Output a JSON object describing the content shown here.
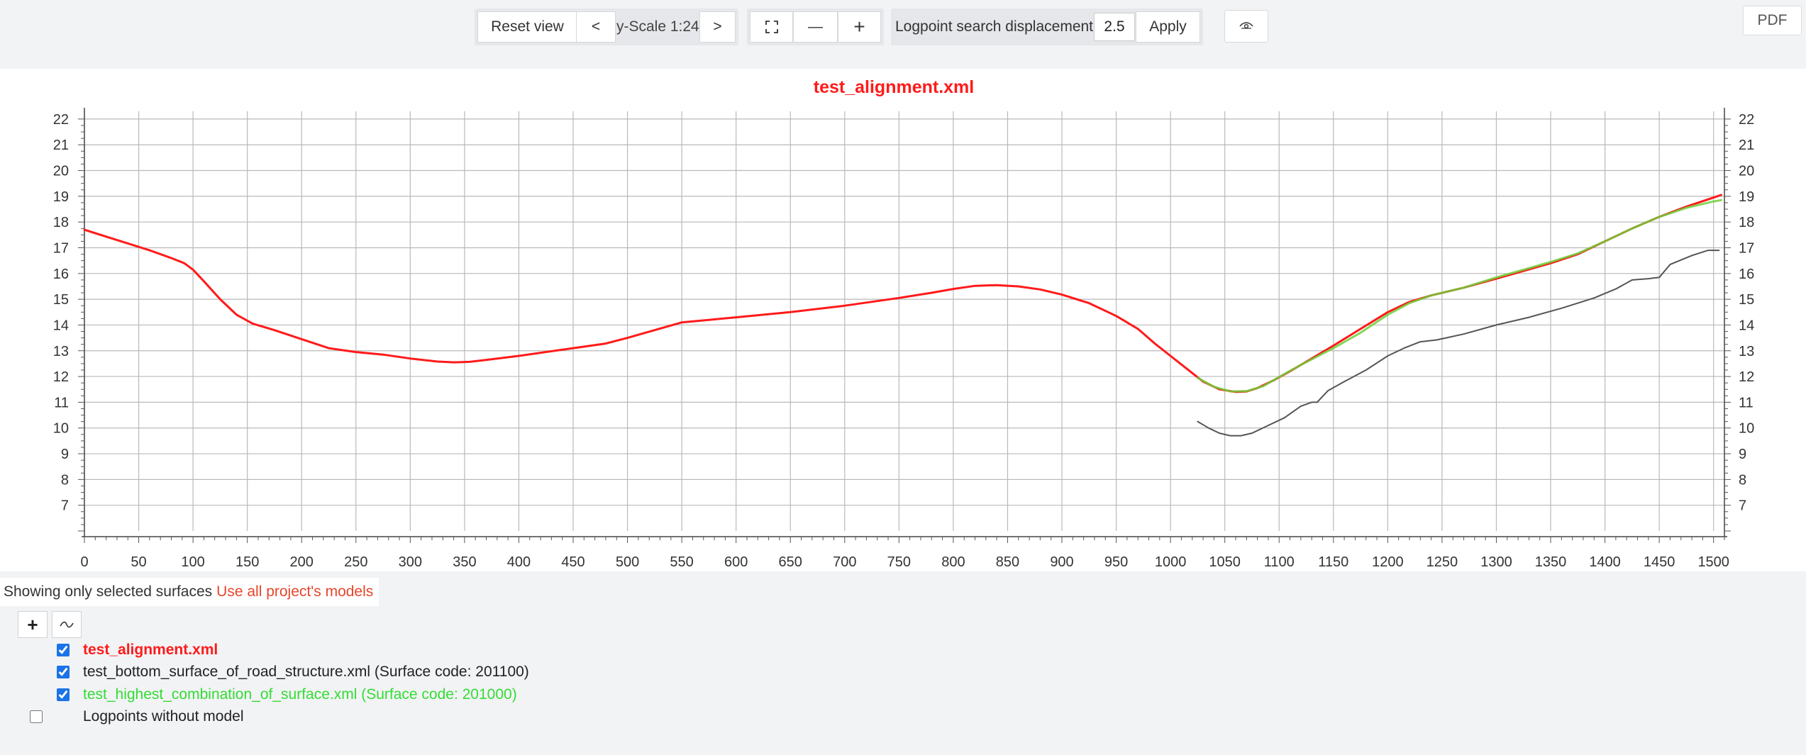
{
  "toolbar": {
    "reset_label": "Reset view",
    "prev_label": "<",
    "scale_text": "y-Scale 1:24",
    "next_label": ">",
    "fullscreen_icon": "fullscreen-icon",
    "zoom_out_label": "—",
    "zoom_in_label": "+",
    "search_label": "Logpoint search displacement",
    "search_value": "2.5",
    "apply_label": "Apply",
    "profile_icon": "eye-toggle-icon",
    "pdf_label": "PDF"
  },
  "legend": {
    "filter_text": "Showing only selected surfaces",
    "filter_link": "Use all project's models",
    "add_label": "+",
    "line_icon": "tilde-line-icon",
    "items": [
      {
        "label": "test_alignment.xml",
        "checked": true,
        "color": "#ff1a1a",
        "bold": true
      },
      {
        "label": "test_bottom_surface_of_road_structure.xml (Surface code: 201100)",
        "checked": true,
        "color": "#222222",
        "bold": false
      },
      {
        "label": "test_highest_combination_of_surface.xml (Surface code: 201000)",
        "checked": true,
        "color": "#33dd33",
        "bold": false
      },
      {
        "label": "Logpoints without model",
        "checked": false,
        "color": "#222222",
        "bold": false
      }
    ]
  },
  "chart_data": {
    "type": "line",
    "title": "test_alignment.xml",
    "xlabel": "",
    "ylabel": "",
    "xlim": [
      0,
      1510
    ],
    "ylim": [
      6,
      22.3
    ],
    "x_ticks": [
      0,
      50,
      100,
      150,
      200,
      250,
      300,
      350,
      400,
      450,
      500,
      550,
      600,
      650,
      700,
      750,
      800,
      850,
      900,
      950,
      1000,
      1050,
      1100,
      1150,
      1200,
      1250,
      1300,
      1350,
      1400,
      1450,
      1500
    ],
    "y_ticks": [
      7,
      8,
      9,
      10,
      11,
      12,
      13,
      14,
      15,
      16,
      17,
      18,
      19,
      20,
      21,
      22
    ],
    "grid": true,
    "series": [
      {
        "name": "test_alignment.xml",
        "color": "#ff1a1a",
        "points": [
          [
            0,
            17.7
          ],
          [
            30,
            17.3
          ],
          [
            60,
            16.9
          ],
          [
            80,
            16.6
          ],
          [
            92,
            16.4
          ],
          [
            100,
            16.15
          ],
          [
            110,
            15.7
          ],
          [
            125,
            15.0
          ],
          [
            140,
            14.4
          ],
          [
            155,
            14.05
          ],
          [
            175,
            13.8
          ],
          [
            200,
            13.45
          ],
          [
            225,
            13.1
          ],
          [
            250,
            12.95
          ],
          [
            275,
            12.85
          ],
          [
            300,
            12.7
          ],
          [
            325,
            12.58
          ],
          [
            340,
            12.55
          ],
          [
            355,
            12.57
          ],
          [
            375,
            12.67
          ],
          [
            400,
            12.8
          ],
          [
            450,
            13.1
          ],
          [
            480,
            13.28
          ],
          [
            500,
            13.5
          ],
          [
            525,
            13.8
          ],
          [
            550,
            14.1
          ],
          [
            575,
            14.2
          ],
          [
            600,
            14.3
          ],
          [
            650,
            14.5
          ],
          [
            700,
            14.75
          ],
          [
            750,
            15.05
          ],
          [
            780,
            15.25
          ],
          [
            800,
            15.4
          ],
          [
            820,
            15.52
          ],
          [
            840,
            15.55
          ],
          [
            860,
            15.5
          ],
          [
            880,
            15.38
          ],
          [
            900,
            15.18
          ],
          [
            925,
            14.85
          ],
          [
            950,
            14.35
          ],
          [
            970,
            13.85
          ],
          [
            985,
            13.3
          ],
          [
            1000,
            12.8
          ],
          [
            1015,
            12.3
          ],
          [
            1030,
            11.8
          ],
          [
            1045,
            11.5
          ],
          [
            1060,
            11.4
          ],
          [
            1070,
            11.42
          ],
          [
            1080,
            11.55
          ],
          [
            1095,
            11.85
          ],
          [
            1110,
            12.2
          ],
          [
            1130,
            12.7
          ],
          [
            1150,
            13.2
          ],
          [
            1175,
            13.85
          ],
          [
            1200,
            14.5
          ],
          [
            1220,
            14.9
          ],
          [
            1240,
            15.15
          ],
          [
            1270,
            15.45
          ],
          [
            1300,
            15.8
          ],
          [
            1350,
            16.4
          ],
          [
            1375,
            16.75
          ],
          [
            1400,
            17.25
          ],
          [
            1425,
            17.75
          ],
          [
            1450,
            18.2
          ],
          [
            1475,
            18.6
          ],
          [
            1500,
            18.95
          ],
          [
            1507,
            19.05
          ]
        ]
      },
      {
        "name": "test_highest_combination_of_surface.xml (Surface code: 201000)",
        "color": "#6ecf3a",
        "points": [
          [
            1025,
            11.95
          ],
          [
            1040,
            11.6
          ],
          [
            1055,
            11.42
          ],
          [
            1070,
            11.43
          ],
          [
            1085,
            11.62
          ],
          [
            1100,
            11.98
          ],
          [
            1120,
            12.45
          ],
          [
            1150,
            13.1
          ],
          [
            1175,
            13.7
          ],
          [
            1200,
            14.4
          ],
          [
            1220,
            14.85
          ],
          [
            1240,
            15.15
          ],
          [
            1270,
            15.45
          ],
          [
            1300,
            15.85
          ],
          [
            1350,
            16.45
          ],
          [
            1375,
            16.78
          ],
          [
            1400,
            17.25
          ],
          [
            1425,
            17.75
          ],
          [
            1450,
            18.2
          ],
          [
            1475,
            18.55
          ],
          [
            1500,
            18.8
          ],
          [
            1507,
            18.85
          ]
        ]
      },
      {
        "name": "test_bottom_surface_of_road_structure.xml (Surface code: 201100)",
        "color": "#555555",
        "points": [
          [
            1025,
            10.25
          ],
          [
            1035,
            10.0
          ],
          [
            1045,
            9.8
          ],
          [
            1055,
            9.7
          ],
          [
            1065,
            9.7
          ],
          [
            1075,
            9.8
          ],
          [
            1090,
            10.1
          ],
          [
            1105,
            10.4
          ],
          [
            1120,
            10.85
          ],
          [
            1130,
            11.0
          ],
          [
            1135,
            11.0
          ],
          [
            1145,
            11.45
          ],
          [
            1160,
            11.8
          ],
          [
            1180,
            12.25
          ],
          [
            1200,
            12.8
          ],
          [
            1215,
            13.1
          ],
          [
            1230,
            13.35
          ],
          [
            1245,
            13.42
          ],
          [
            1270,
            13.65
          ],
          [
            1300,
            14.0
          ],
          [
            1330,
            14.3
          ],
          [
            1360,
            14.65
          ],
          [
            1390,
            15.05
          ],
          [
            1410,
            15.4
          ],
          [
            1425,
            15.75
          ],
          [
            1440,
            15.8
          ],
          [
            1450,
            15.85
          ],
          [
            1460,
            16.35
          ],
          [
            1480,
            16.7
          ],
          [
            1495,
            16.9
          ],
          [
            1505,
            16.9
          ]
        ]
      }
    ]
  }
}
